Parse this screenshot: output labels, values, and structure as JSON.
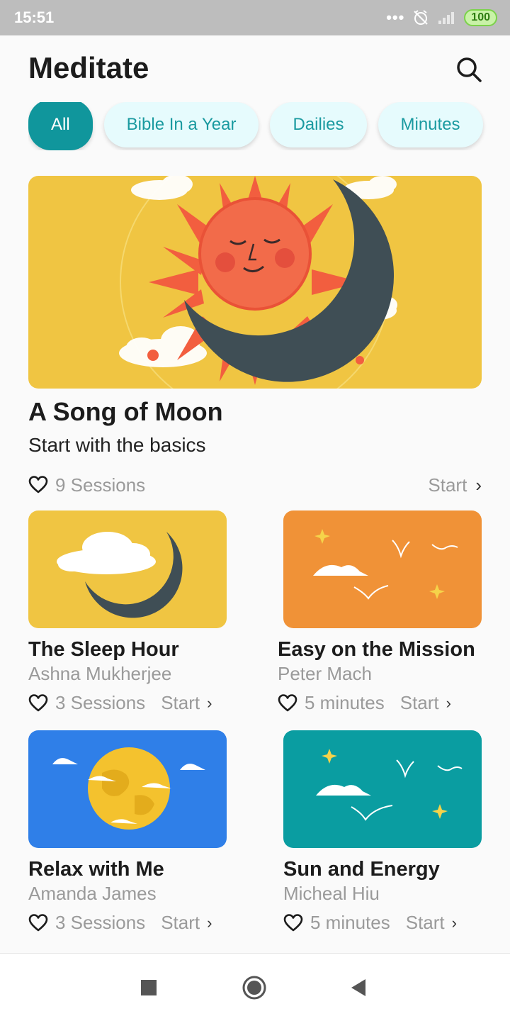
{
  "status_bar": {
    "time": "15:51",
    "battery": "100"
  },
  "header": {
    "title": "Meditate",
    "search_icon": "search-icon"
  },
  "filters": [
    {
      "label": "All",
      "active": true
    },
    {
      "label": "Bible In a Year",
      "active": false
    },
    {
      "label": "Dailies",
      "active": false
    },
    {
      "label": "Minutes",
      "active": false
    }
  ],
  "featured": {
    "title": "A Song of Moon",
    "subtitle": "Start with the basics",
    "meta": "9 Sessions",
    "start_label": "Start",
    "image_bg": "#f0c542"
  },
  "cards": [
    {
      "title": "The Sleep Hour",
      "author": "Ashna Mukherjee",
      "meta": "3 Sessions",
      "start_label": "Start",
      "image_bg": "#f0c542"
    },
    {
      "title": "Easy on the Mission",
      "author": "Peter Mach",
      "meta": "5 minutes",
      "start_label": "Start",
      "image_bg": "#f09237"
    },
    {
      "title": "Relax with Me",
      "author": "Amanda James",
      "meta": "3 Sessions",
      "start_label": "Start",
      "image_bg": "#2f7fe8"
    },
    {
      "title": "Sun and Energy",
      "author": "Micheal Hiu",
      "meta": "5 minutes",
      "start_label": "Start",
      "image_bg": "#0a9da1"
    }
  ],
  "colors": {
    "accent": "#10969c",
    "chip_bg": "#e6fbfd",
    "muted_text": "#9a9a9a"
  }
}
